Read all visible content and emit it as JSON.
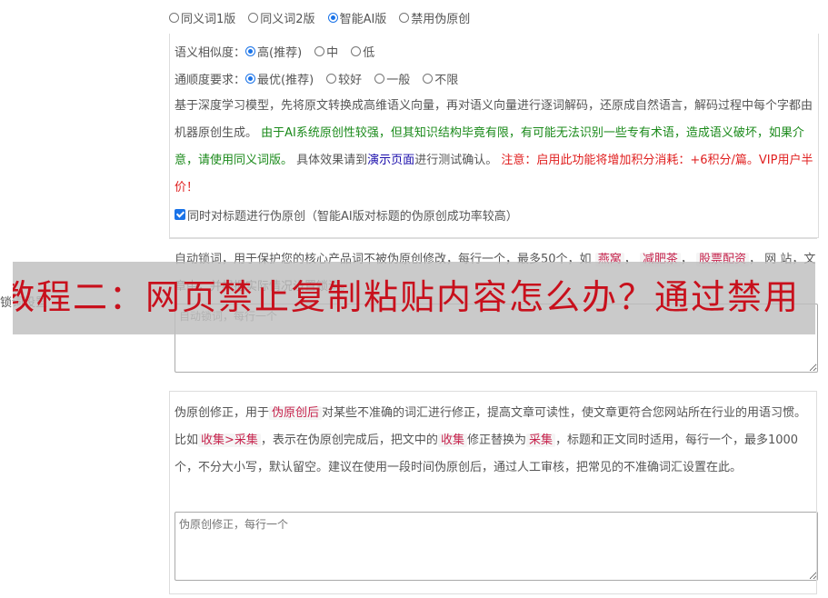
{
  "version_options": [
    {
      "label": "同义词1版",
      "checked": false
    },
    {
      "label": "同义词2版",
      "checked": false
    },
    {
      "label": "智能AI版",
      "checked": true
    },
    {
      "label": "禁用伪原创",
      "checked": false
    }
  ],
  "similarity": {
    "label": "语义相似度：",
    "options": [
      "高(推荐)",
      "中",
      "低"
    ]
  },
  "fluency": {
    "label": "通顺度要求：",
    "options": [
      "最优(推荐)",
      "较好",
      "一般",
      "不限"
    ]
  },
  "desc": {
    "part1": "基于深度学习模型，先将原文转换成高维语义向量，再对语义向量进行逐词解码，还原成自然语言，解码过程中每个字都由机器原创生成。",
    "part2": "由于AI系统原创性较强，但其知识结构毕竟有限，有可能无法识别一些专有术语，造成语义破坏，如果介意，请使用同义词版。",
    "part3a": "具体效果请到",
    "link": "演示页面",
    "part3b": "进行测试确认。",
    "note": "注意：启用此功能将增加积分消耗：+6积分/篇。VIP用户半价！"
  },
  "title_checkbox_label": "同时对标题进行伪原创（智能AI版对标题的伪原创成功率较高）",
  "lock": {
    "text_a": "自动锁词，用于保护您的核心产品词不被伪原创修改，每行一个，最多50个，如",
    "tags": [
      "燕窝",
      "减肥茶",
      "股票配资"
    ],
    "text_b": "网",
    "line2": "站，文章中，并根据实际情况设置锁词。",
    "placeholder": "自动锁词，每行一个"
  },
  "correction": {
    "t1": "伪原创修正，用于",
    "tag1": "伪原创后",
    "t2": "对某些不准确的词汇进行修正，提高文章可读性，使文章更符合您网站所在行业的用语习惯。比如",
    "tag2": "收集>采集",
    "t3": "，表示在伪原创完成后，把文中的",
    "tag3": "收集",
    "t4": "修正替换为",
    "tag4": "采集",
    "t5": "，标题和正文同时适用，每行一个，最多1000个，不分大小写，默认留空。建议在使用一段时间伪原创后，通过人工审核，把常见的不准确词汇设置在此。",
    "placeholder": "伪原创修正，每行一个"
  },
  "left_label": "锁词设置",
  "overlay_text": "教程二：网页禁止复制粘贴内容怎么办？通过禁用"
}
